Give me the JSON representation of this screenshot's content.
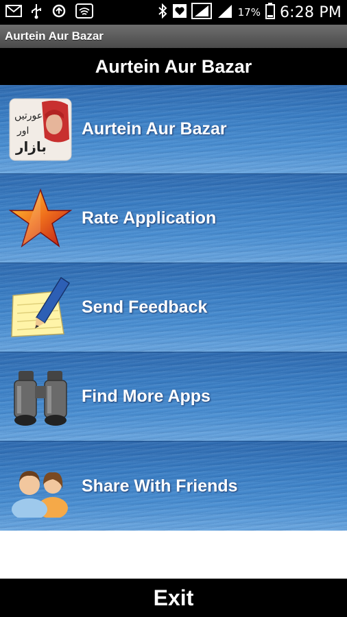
{
  "status_bar": {
    "battery_percent": "17%",
    "time": "6:28 PM",
    "icons": [
      "mail-icon",
      "usb-icon",
      "sync-icon",
      "wifi-icon",
      "bluetooth-icon",
      "heart-icon",
      "signal-icon",
      "signal-icon",
      "battery-icon"
    ]
  },
  "app": {
    "title": "Aurtein Aur Bazar"
  },
  "header": {
    "title": "Aurtein Aur Bazar"
  },
  "menu": {
    "items": [
      {
        "label": "Aurtein Aur Bazar",
        "icon": "book-cover-icon",
        "urdu_lines": [
          "عورتیں",
          "اور",
          "بازار"
        ]
      },
      {
        "label": "Rate Application",
        "icon": "star-icon"
      },
      {
        "label": "Send Feedback",
        "icon": "notepad-pencil-icon"
      },
      {
        "label": "Find More Apps",
        "icon": "binoculars-icon"
      },
      {
        "label": "Share With Friends",
        "icon": "people-icon"
      }
    ]
  },
  "exit": {
    "label": "Exit"
  },
  "colors": {
    "menu_blue": "#3a7ec4",
    "bar_black": "#000000",
    "title_gray": "#5a5a5a"
  }
}
